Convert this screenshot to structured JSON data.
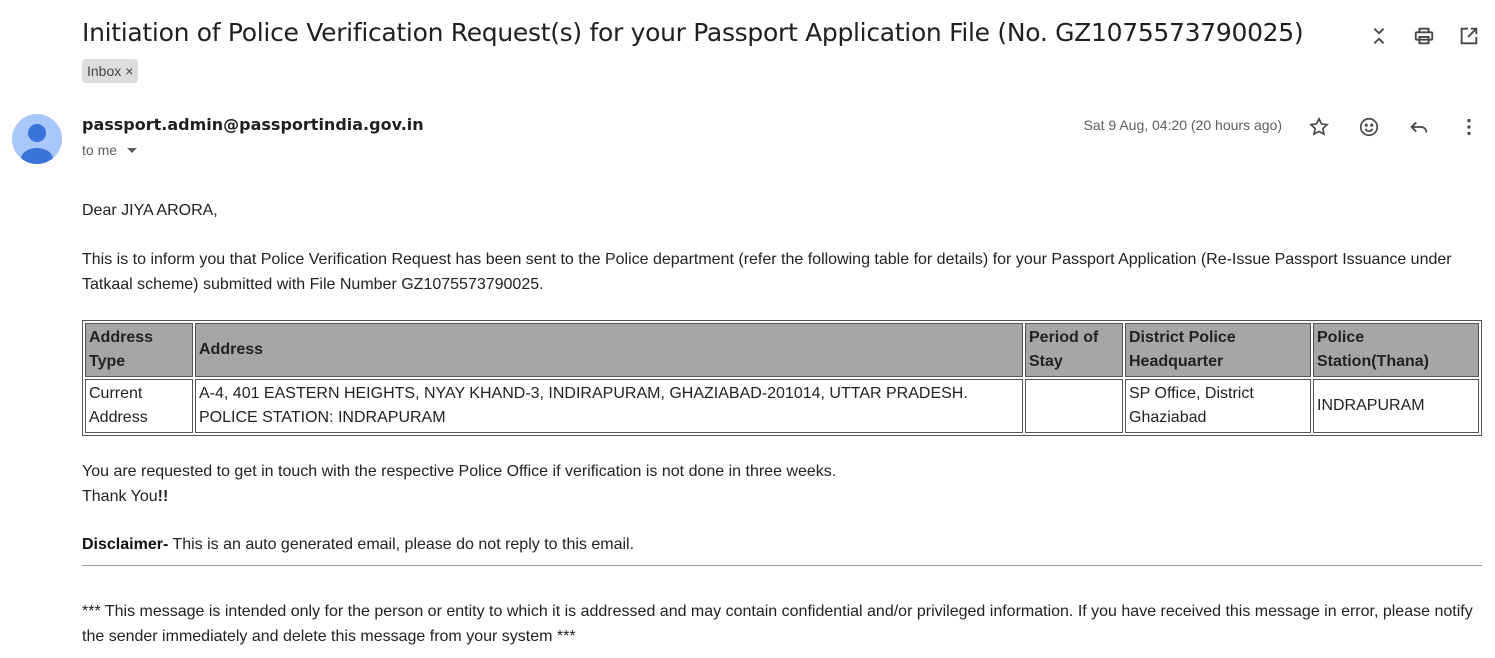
{
  "email": {
    "subject": "Initiation of Police Verification Request(s) for your Passport Application File (No. GZ1075573790025)",
    "label": "Inbox",
    "label_remove": "×",
    "sender": "passport.admin@passportindia.gov.in",
    "to": "to me",
    "date": "Sat 9 Aug, 04:20 (20 hours ago)"
  },
  "icons": {
    "top": [
      "collapse-icon",
      "print-icon",
      "open-new-window-icon"
    ],
    "message": [
      "star-icon",
      "emoji-icon",
      "reply-icon",
      "more-vert-icon"
    ]
  },
  "body": {
    "greeting": "Dear JIYA ARORA,",
    "intro": "This is to inform you that Police Verification Request has been sent to the Police department (refer the following table for details) for your Passport Application (Re-Issue Passport Issuance under Tatkaal scheme) submitted with File Number GZ1075573790025.",
    "request": "You are requested to get in touch with the respective Police Office if verification is not done in three weeks.",
    "thanks_prefix": "Thank You",
    "thanks_suffix": "!!",
    "disclaimer_label": "Disclaimer-",
    "disclaimer_text": " This is an auto generated email, please do not reply to this email.",
    "footer": "*** This message is intended only for the person or entity to which it is addressed and may contain confidential and/or privileged information. If you have received this message in error, please notify the sender immediately and delete this message from your system ***"
  },
  "table": {
    "headers": [
      "Address Type",
      "Address",
      "Period of Stay",
      "District Police Headquarter",
      "Police Station(Thana)"
    ],
    "rows": [
      [
        "Current Address",
        "A-4, 401 EASTERN HEIGHTS, NYAY KHAND-3, INDIRAPURAM, GHAZIABAD-201014, UTTAR PRADESH. POLICE STATION: INDRAPURAM",
        "",
        "SP Office, District Ghaziabad",
        "INDRAPURAM"
      ]
    ]
  },
  "colors": {
    "avatar_bg": "#a8c7fa",
    "avatar_fg": "#3a74d8",
    "table_header_bg": "#a6a6a6",
    "chip_bg": "#dddddd"
  }
}
